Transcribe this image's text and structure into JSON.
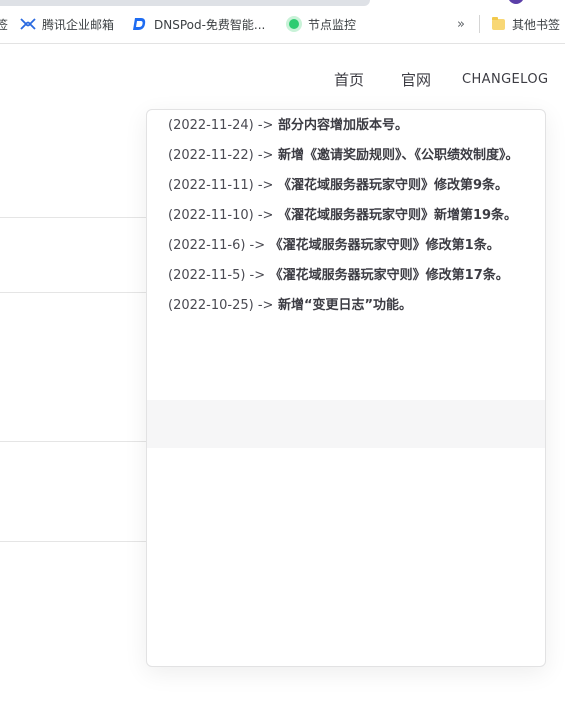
{
  "bookmarks": {
    "cut_item": "签",
    "items": [
      {
        "label": "腾讯企业邮箱",
        "icon": "tencent-exmail-icon"
      },
      {
        "label": "DNSPod-免费智能...",
        "icon": "dnspod-icon"
      },
      {
        "label": "节点监控",
        "icon": "green-dot-icon"
      }
    ],
    "more": "»",
    "other": "其他书签"
  },
  "nav": {
    "home": "首页",
    "official_site": "官网",
    "changelog": "CHANGELOG"
  },
  "changelog": [
    {
      "date": "(2022-11-24) ->",
      "text": "部分内容增加版本号。"
    },
    {
      "date": "(2022-11-22) ->",
      "text": "新增《邀请奖励规则》、《公职绩效制度》。"
    },
    {
      "date": "(2022-11-11) ->",
      "text": "《濯花域服务器玩家守则》修改第9条。"
    },
    {
      "date": "(2022-11-10) ->",
      "text": "《濯花域服务器玩家守则》新增第19条。"
    },
    {
      "date": "(2022-11-6) ->",
      "text": "《濯花域服务器玩家守则》修改第1条。"
    },
    {
      "date": "(2022-11-5) ->",
      "text": "《濯花域服务器玩家守则》修改第17条。"
    },
    {
      "date": "(2022-10-25) ->",
      "text": "新增“变更日志”功能。"
    }
  ],
  "colors": {
    "accent_purple": "#5b3fa8",
    "folder_yellow": "#f8d775",
    "dns_blue": "#1e6cf2",
    "exmail_blue": "#2a6ae0",
    "status_green": "#2ecc71"
  }
}
